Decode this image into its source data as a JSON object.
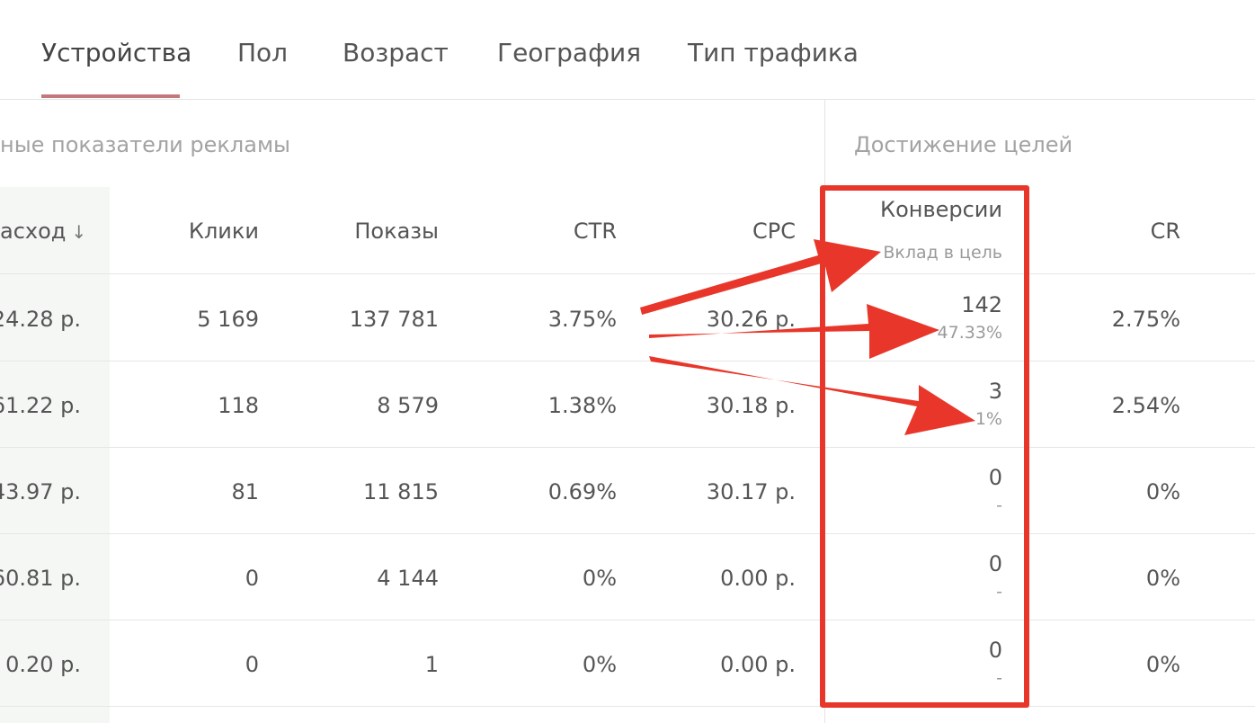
{
  "tabs": [
    {
      "label": "Устройства",
      "active": true
    },
    {
      "label": "Пол"
    },
    {
      "label": "Возраст"
    },
    {
      "label": "География"
    },
    {
      "label": "Тип трафика"
    }
  ],
  "groups": {
    "ad_metrics": "ные показатели рекламы",
    "goals": "Достижение целей"
  },
  "columns": {
    "spend": "асход",
    "clicks": "Клики",
    "impressions": "Показы",
    "ctr": "CTR",
    "cpc": "CPC",
    "conversions": "Конверсии",
    "conversions_sub": "Вклад в цель",
    "cr": "CR"
  },
  "rows": [
    {
      "spend": "24.28 р.",
      "clicks": "5 169",
      "impressions": "137 781",
      "ctr": "3.75%",
      "cpc": "30.26 р.",
      "conversions": "142",
      "contribution": "47.33%",
      "cr": "2.75%"
    },
    {
      "spend": "61.22 р.",
      "clicks": "118",
      "impressions": "8 579",
      "ctr": "1.38%",
      "cpc": "30.18 р.",
      "conversions": "3",
      "contribution": "1%",
      "cr": "2.54%"
    },
    {
      "spend": "43.97 р.",
      "clicks": "81",
      "impressions": "11 815",
      "ctr": "0.69%",
      "cpc": "30.17 р.",
      "conversions": "0",
      "contribution": "-",
      "cr": "0%"
    },
    {
      "spend": "60.81 р.",
      "clicks": "0",
      "impressions": "4 144",
      "ctr": "0%",
      "cpc": "0.00 р.",
      "conversions": "0",
      "contribution": "-",
      "cr": "0%"
    },
    {
      "spend": "0.20 р.",
      "clicks": "0",
      "impressions": "1",
      "ctr": "0%",
      "cpc": "0.00 р.",
      "conversions": "0",
      "contribution": "-",
      "cr": "0%"
    }
  ],
  "colors": {
    "tab_underline": "#c5787a",
    "annotation": "#e8372a",
    "sorted_column_bg": "#f5f7f5"
  },
  "icons": {
    "sort": "arrow-down-icon"
  }
}
